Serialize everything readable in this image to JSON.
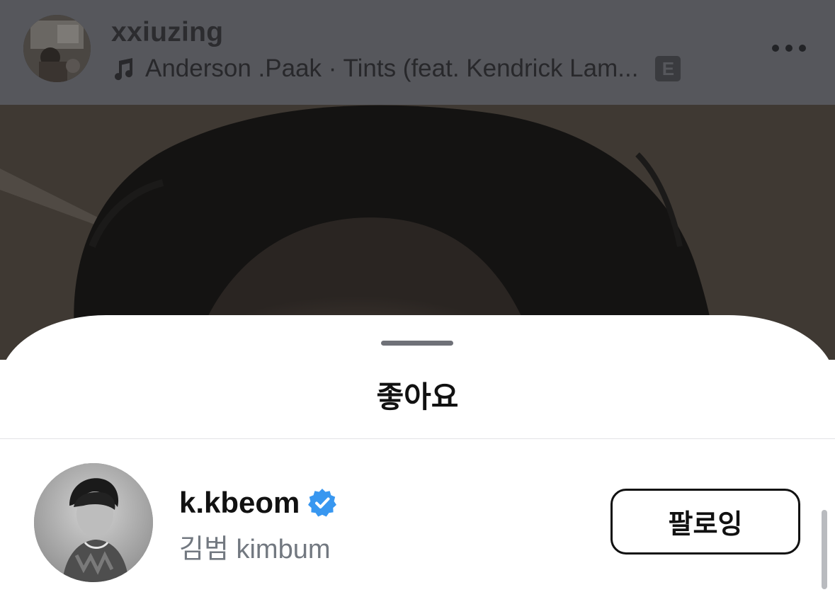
{
  "post_header": {
    "username": "xxiuzing",
    "music_text": "Anderson .Paak · Tints (feat. Kendrick Lam...",
    "explicit_badge": "E",
    "icons": {
      "music": "music-note-icon",
      "more": "more-dots-icon"
    }
  },
  "likes_sheet": {
    "title": "좋아요",
    "users": [
      {
        "handle": "k.kbeom",
        "full_name": "김범 kimbum",
        "verified": true,
        "button_label": "팔로잉"
      }
    ]
  },
  "colors": {
    "dimmed_header": "#56575c",
    "verified_blue": "#3897f0",
    "secondary_text": "#727880"
  }
}
